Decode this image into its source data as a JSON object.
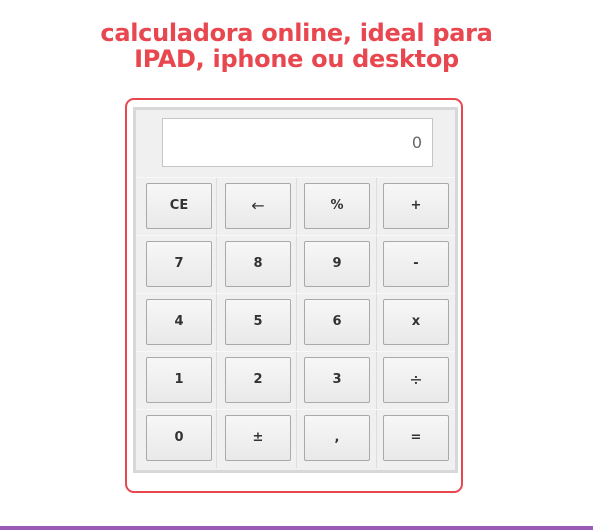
{
  "title": {
    "line1": "calculadora online, ideal para",
    "line2": "IPAD, iphone ou desktop"
  },
  "display": {
    "value": "0"
  },
  "keys": [
    [
      "CE",
      "←",
      "%",
      "+"
    ],
    [
      "7",
      "8",
      "9",
      "-"
    ],
    [
      "4",
      "5",
      "6",
      "x"
    ],
    [
      "1",
      "2",
      "3",
      "÷"
    ],
    [
      "0",
      "±",
      ",",
      "="
    ]
  ],
  "colors": {
    "title": "#e8474f",
    "frame": "#e8474f",
    "bottom_bar": "#9a5bb5"
  }
}
